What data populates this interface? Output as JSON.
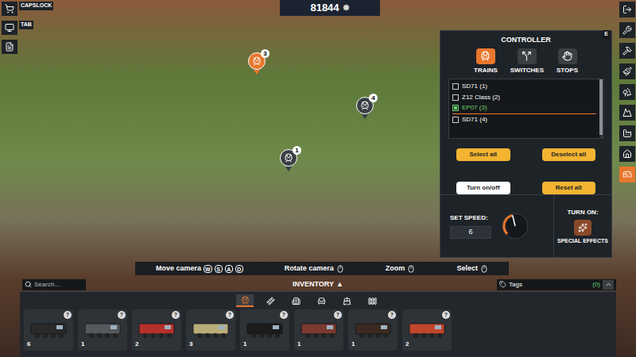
{
  "top_bar": {
    "coins": "81844"
  },
  "left_toolbar": [
    {
      "key": "CAPSLOCK",
      "selected": false
    },
    {
      "key": "TAB",
      "selected": false
    },
    {
      "selected": false
    }
  ],
  "right_toolbar": [
    {
      "selected": false
    },
    {
      "selected": false
    },
    {
      "selected": false
    },
    {
      "selected": false
    },
    {
      "selected": false
    },
    {
      "selected": false
    },
    {
      "selected": false
    },
    {
      "selected": false
    },
    {
      "selected": true
    }
  ],
  "train_markers": [
    {
      "label": "3",
      "selected": true
    },
    {
      "label": "4",
      "selected": false
    },
    {
      "label": "1",
      "selected": false
    }
  ],
  "controller": {
    "title": "CONTROLLER",
    "close_key": "E",
    "tabs": [
      {
        "label": "TRAINS",
        "selected": true
      },
      {
        "label": "SWITCHES",
        "selected": false
      },
      {
        "label": "STOPS",
        "selected": false
      }
    ],
    "trains": [
      {
        "name": "SD71 (1)",
        "checked": false,
        "selected": false
      },
      {
        "name": "Z12 Class (2)",
        "checked": false,
        "selected": false
      },
      {
        "name": "EP07 (3)",
        "checked": true,
        "selected": true
      },
      {
        "name": "SD71 (4)",
        "checked": false,
        "selected": false
      }
    ],
    "buttons": [
      {
        "label": "Select all",
        "highlighted": false
      },
      {
        "label": "Deselect all",
        "highlighted": false
      },
      {
        "label": "Turn on/off",
        "highlighted": true
      },
      {
        "label": "Reset all",
        "highlighted": false
      }
    ],
    "speed": {
      "label": "SET SPEED:",
      "value": "6",
      "level": 0.45
    },
    "effects": {
      "label": "TURN ON:",
      "button": "SPECIAL EFFECTS"
    }
  },
  "hints": [
    {
      "label": "Move camera",
      "keys": [
        "W",
        "S",
        "A",
        "D"
      ]
    },
    {
      "label": "Rotate camera",
      "keys": []
    },
    {
      "label": "Zoom",
      "keys": []
    },
    {
      "label": "Select",
      "keys": []
    }
  ],
  "search": {
    "placeholder": "Search..."
  },
  "inventory": {
    "title": "INVENTORY",
    "arrow": "▲",
    "tabs": [
      {
        "selected": true
      },
      {
        "selected": false
      },
      {
        "selected": false
      },
      {
        "selected": false
      },
      {
        "selected": false
      },
      {
        "selected": false
      }
    ],
    "items": [
      {
        "badge": "?",
        "count": "6",
        "color": "#2a2a2a"
      },
      {
        "badge": "?",
        "count": "1",
        "color": "#55585c"
      },
      {
        "badge": "?",
        "count": "2",
        "color": "#b3312a"
      },
      {
        "badge": "?",
        "count": "3",
        "color": "#b8ad7a"
      },
      {
        "badge": "?",
        "count": "1",
        "color": "#1c1c1c"
      },
      {
        "badge": "?",
        "count": "1",
        "color": "#7a3a30"
      },
      {
        "badge": "?",
        "count": "1",
        "color": "#3a2a22"
      },
      {
        "badge": "?",
        "count": "2",
        "color": "#c0462c"
      }
    ]
  },
  "tags": {
    "label": "Tags",
    "count": "(0)"
  }
}
